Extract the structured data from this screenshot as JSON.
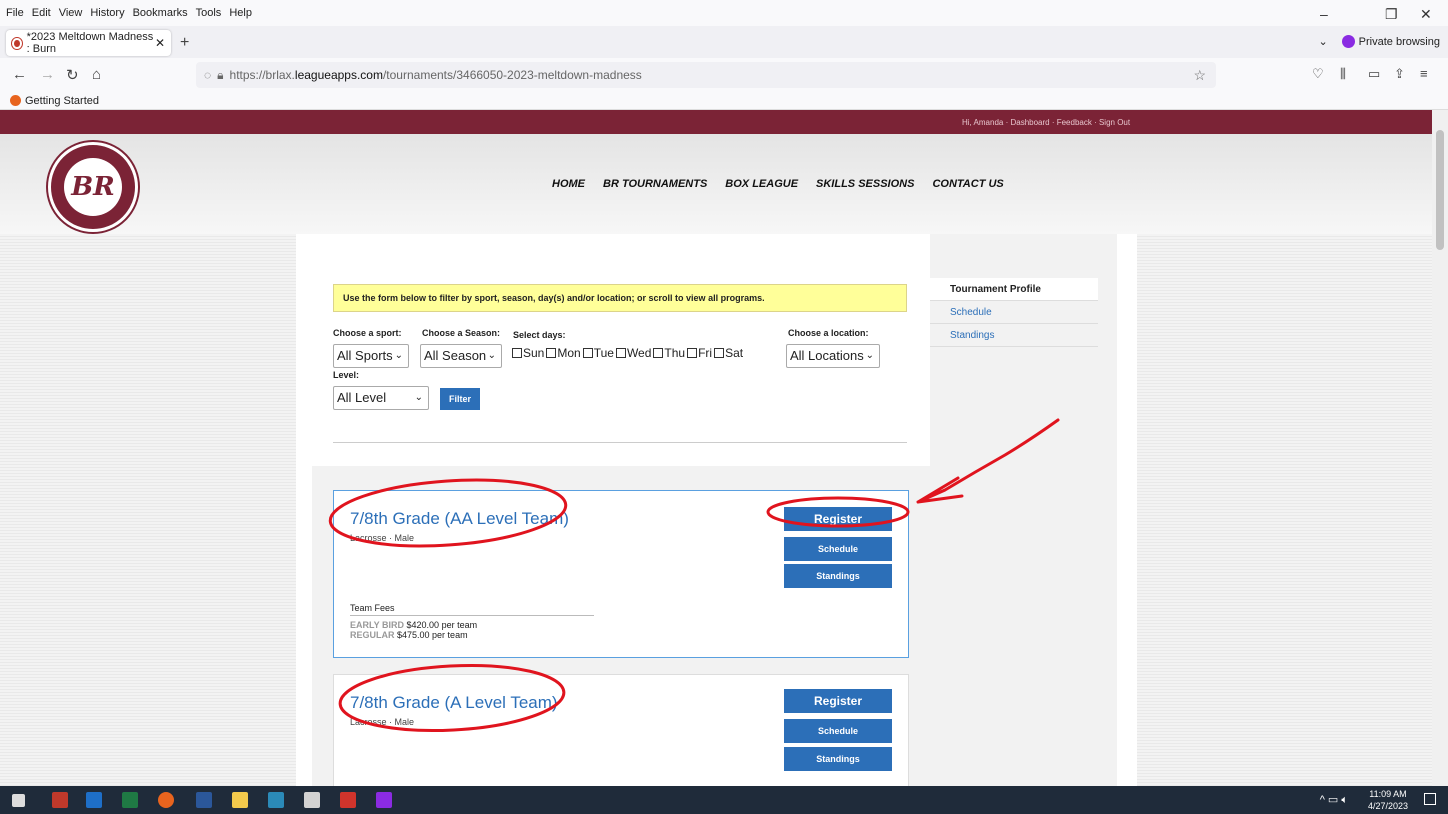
{
  "browser": {
    "menu": [
      "File",
      "Edit",
      "View",
      "History",
      "Bookmarks",
      "Tools",
      "Help"
    ],
    "tab_title": "*2023 Meltdown Madness : Burn",
    "private_label": "Private browsing",
    "url_prefix": "https://brlax.",
    "url_host": "leagueapps.com",
    "url_path": "/tournaments/3466050-2023-meltdown-madness",
    "bookmark": "Getting Started"
  },
  "site": {
    "top_links": "Hi, Amanda · Dashboard · Feedback · Sign Out",
    "logo_text": "BR",
    "nav": [
      "HOME",
      "BR TOURNAMENTS",
      "BOX LEAGUE",
      "SKILLS SESSIONS",
      "CONTACT US"
    ]
  },
  "filter": {
    "notice": "Use the form below to filter by sport, season, day(s) and/or location; or scroll to view all programs.",
    "sport_label": "Choose a sport:",
    "sport_value": "All Sports",
    "season_label": "Choose a Season:",
    "season_value": "All Season",
    "days_label": "Select days:",
    "days": [
      "Sun",
      "Mon",
      "Tue",
      "Wed",
      "Thu",
      "Fri",
      "Sat"
    ],
    "location_label": "Choose a location:",
    "location_value": "All Locations",
    "level_label": "Level:",
    "level_value": "All Level",
    "filter_button": "Filter"
  },
  "sidebar": [
    "Tournament Profile",
    "Schedule",
    "Standings"
  ],
  "programs": [
    {
      "title": "7/8th Grade (AA Level Team)",
      "sub": "Lacrosse · Male",
      "register": "Register",
      "schedule": "Schedule",
      "standings": "Standings",
      "fees_title": "Team Fees",
      "early_label": "EARLY BIRD",
      "early_value": "$420.00 per team",
      "regular_label": "REGULAR",
      "regular_value": "$475.00 per team"
    },
    {
      "title": "7/8th Grade (A Level Team)",
      "sub": "Lacrosse · Male",
      "register": "Register",
      "schedule": "Schedule",
      "standings": "Standings"
    }
  ],
  "taskbar": {
    "time": "11:09 AM",
    "date": "4/27/2023"
  },
  "colors": {
    "brand": "#7b2336",
    "button": "#2c6fb8",
    "annotation": "#e0141e"
  }
}
